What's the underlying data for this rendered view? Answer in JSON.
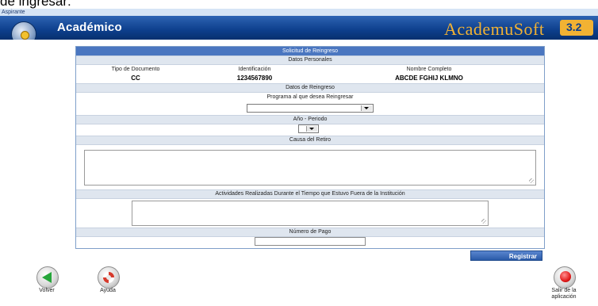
{
  "snippet_text": "de ingresar:",
  "window": {
    "role_label": "Aspirante",
    "module_title": "Académico",
    "brand_name": "AcademuSoft",
    "brand_version": "3.2"
  },
  "form": {
    "title": "Solicitud de Reingreso",
    "personal_section": "Datos Personales",
    "columns": [
      "Tipo de Documento",
      "Identificación",
      "Nombre Completo"
    ],
    "values": {
      "tipo_documento": "CC",
      "identificacion": "1234567890",
      "nombre_completo": "ABCDE FGHIJ KLMNO"
    },
    "reentry_section": "Datos de Reingreso",
    "program_label": "Programa al que desea Reingresar",
    "program_selected": "",
    "period_label": "Año - Periodo",
    "period_selected": "",
    "withdrawal_label": "Causa del Retiro",
    "withdrawal_value": "",
    "activities_label": "Actividades Realizadas Durante el Tiempo que Estuvo Fuera de la Institución",
    "activities_value": "",
    "payment_label": "Número de Pago",
    "payment_value": "",
    "submit_label": "Registrar"
  },
  "footer": {
    "back_label": "Volver",
    "help_label": "Ayuda",
    "exit_label_line1": "Salir de la",
    "exit_label_line2": "aplicación"
  },
  "colors": {
    "header_blue": "#0d3f8c",
    "brand_orange": "#f2b233",
    "section_blue": "#4a76c0"
  }
}
